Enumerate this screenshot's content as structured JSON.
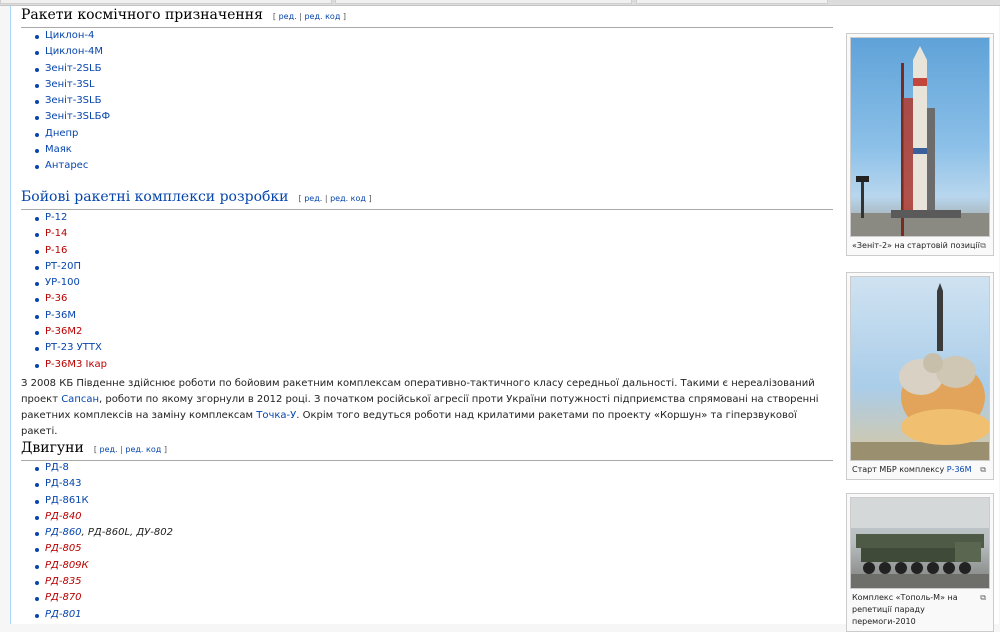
{
  "sections": {
    "space": {
      "title": "Ракети космічного призначення",
      "edit_open": "[",
      "edit": "ред.",
      "sep": "|",
      "edit_code": "ред. код",
      "edit_close": "]",
      "items": [
        "Циклон-4",
        "Циклон-4М",
        "Зеніт-2SLБ",
        "Зеніт-3SL",
        "Зеніт-3SLБ",
        "Зеніт-3SLБФ",
        "Днепр",
        "Маяк",
        "Антарес"
      ]
    },
    "combat": {
      "title": "Бойові ракетні комплекси розробки",
      "edit_open": "[",
      "edit": "ред.",
      "sep": "|",
      "edit_code": "ред. код",
      "edit_close": "]",
      "items": [
        {
          "label": "Р-12",
          "color": "#0645ad"
        },
        {
          "label": "Р-14",
          "color": "#ba0000"
        },
        {
          "label": "Р-16",
          "color": "#ba0000"
        },
        {
          "label": "РТ-20П",
          "color": "#0645ad"
        },
        {
          "label": "УР-100",
          "color": "#0645ad"
        },
        {
          "label": "Р-36",
          "color": "#ba0000"
        },
        {
          "label": "Р-36М",
          "color": "#0645ad"
        },
        {
          "label": "Р-36М2",
          "color": "#ba0000"
        },
        {
          "label": "РТ-23 УТТХ",
          "color": "#0645ad"
        },
        {
          "label": "Р-36М3 Ікар",
          "color": "#ba0000"
        }
      ],
      "paragraph": {
        "p1": "З 2008 КБ Південне здійснює роботи по бойовим ракетним комплексам оперативно-тактичного класу середньої дальності. Такими є нереалізований проект ",
        "link1": "Сапсан",
        "p2": ", роботи по якому згорнули в 2012 році. З початком російської агресії проти України потужності підприємства спрямовані на створенні ракетних комплексів на заміну комплексам ",
        "link2": "Точка-У",
        "p3": ". Окрім того ведуться роботи над крилатими ракетами по проекту «Коршун» та гіперзвукової ракеті."
      }
    },
    "engines": {
      "title": "Двигуни",
      "edit_open": "[",
      "edit": "ред.",
      "sep": "|",
      "edit_code": "ред. код",
      "edit_close": "]",
      "items": [
        {
          "label": "РД-8",
          "color": "#0645ad",
          "italic": false,
          "rest": ""
        },
        {
          "label": "РД-843",
          "color": "#0645ad",
          "italic": false,
          "rest": ""
        },
        {
          "label": "РД-861К",
          "color": "#0645ad",
          "italic": false,
          "rest": ""
        },
        {
          "label": "РД-840",
          "color": "#ba0000",
          "italic": true,
          "rest": ""
        },
        {
          "label": "РД-860",
          "color": "#0645ad",
          "italic": true,
          "rest": ", РД-860L, ДУ-802"
        },
        {
          "label": "РД-805",
          "color": "#ba0000",
          "italic": true,
          "rest": ""
        },
        {
          "label": "РД-809К",
          "color": "#ba0000",
          "italic": true,
          "rest": ""
        },
        {
          "label": "РД-835",
          "color": "#ba0000",
          "italic": true,
          "rest": ""
        },
        {
          "label": "РД-870",
          "color": "#ba0000",
          "italic": true,
          "rest": ""
        },
        {
          "label": "РД-801",
          "color": "#0645ad",
          "italic": true,
          "rest": ""
        }
      ]
    }
  },
  "thumbs": {
    "zenit": {
      "caption": "«Зеніт-2» на стартовій позиції",
      "mag": "⧉"
    },
    "r36m": {
      "caption_pre": "Старт МБР комплексу ",
      "caption_link": "Р-36М",
      "mag": "⧉"
    },
    "topol": {
      "caption": "Комплекс «Тополь-М» на репетиції параду перемоги-2010",
      "mag": "⧉"
    }
  },
  "colors": {
    "link": "#0645ad",
    "redlink": "#ba0000",
    "border": "#a7d7f9"
  }
}
